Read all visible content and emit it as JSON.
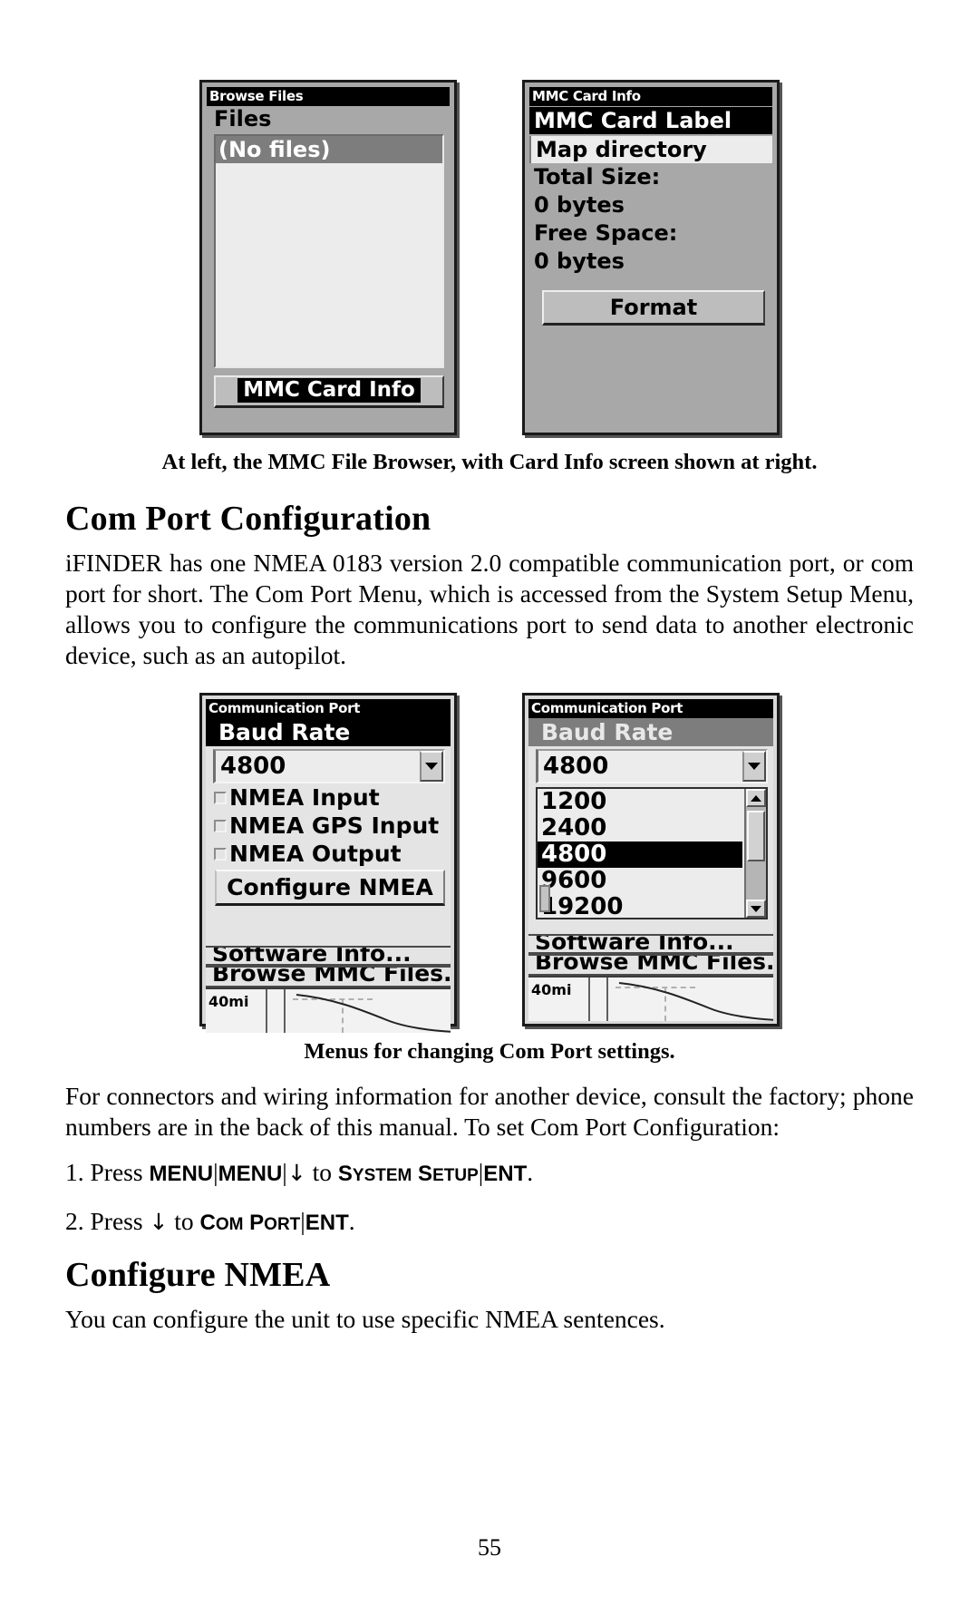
{
  "figure1": {
    "browse_files": {
      "titlebar": "Browse Files",
      "header": "Files",
      "selected_item": "(No files)",
      "button": "MMC Card Info"
    },
    "card_info": {
      "titlebar": "MMC Card Info",
      "label_header": "MMC Card Label",
      "label_value": "Map directory",
      "total_size_label": "Total Size:",
      "total_size_value": "0 bytes",
      "free_space_label": "Free Space:",
      "free_space_value": "0 bytes",
      "button": "Format"
    },
    "caption": "At left, the MMC File Browser, with Card Info screen shown at right."
  },
  "section1": {
    "heading": "Com Port Configuration",
    "paragraph": "iFINDER has one NMEA 0183 version 2.0 compatible communication port, or com port for short. The Com Port Menu, which is accessed from the System Setup Menu, allows you to configure the communications port to send data to another electronic device, such as an autopilot."
  },
  "figure2": {
    "comport_left": {
      "titlebar": "Communication Port",
      "baud_header": "Baud Rate",
      "baud_value": "4800",
      "checkboxes": [
        "NMEA Input",
        "NMEA GPS Input",
        "NMEA Output"
      ],
      "button": "Configure NMEA",
      "menu_items": [
        "Software Info...",
        "Browse MMC Files..."
      ],
      "map_scale": "40mi"
    },
    "comport_right": {
      "titlebar": "Communication Port",
      "baud_header": "Baud Rate",
      "baud_value": "4800",
      "options": [
        "1200",
        "2400",
        "4800",
        "9600",
        "19200"
      ],
      "selected_option": "4800",
      "menu_items": [
        "Software Info...",
        "Browse MMC Files..."
      ],
      "map_scale": "40mi"
    },
    "caption": "Menus for changing Com Port settings."
  },
  "section2": {
    "paragraph": "For connectors and wiring information for another device, consult the factory; phone numbers are in the back of this manual. To set Com Port Configuration:",
    "steps": [
      {
        "number": "1.",
        "press": "Press",
        "key1": "MENU",
        "key2": "MENU",
        "arrow": "↓",
        "to": "to",
        "target_upper1": "S",
        "target_lower1": "YSTEM",
        "target_upper2": "S",
        "target_lower2": "ETUP",
        "ent": "ENT",
        "period": ".",
        "sep": "|"
      },
      {
        "number": "2.",
        "press": "Press",
        "arrow": "↓",
        "to": "to",
        "target_upper1": "C",
        "target_lower1": "OM",
        "target_upper2": "P",
        "target_lower2": "ORT",
        "ent": "ENT",
        "period": ".",
        "sep": "|"
      }
    ]
  },
  "section3": {
    "heading": "Configure NMEA",
    "paragraph": "You can configure the unit to use specific NMEA sentences."
  },
  "page_number": "55"
}
